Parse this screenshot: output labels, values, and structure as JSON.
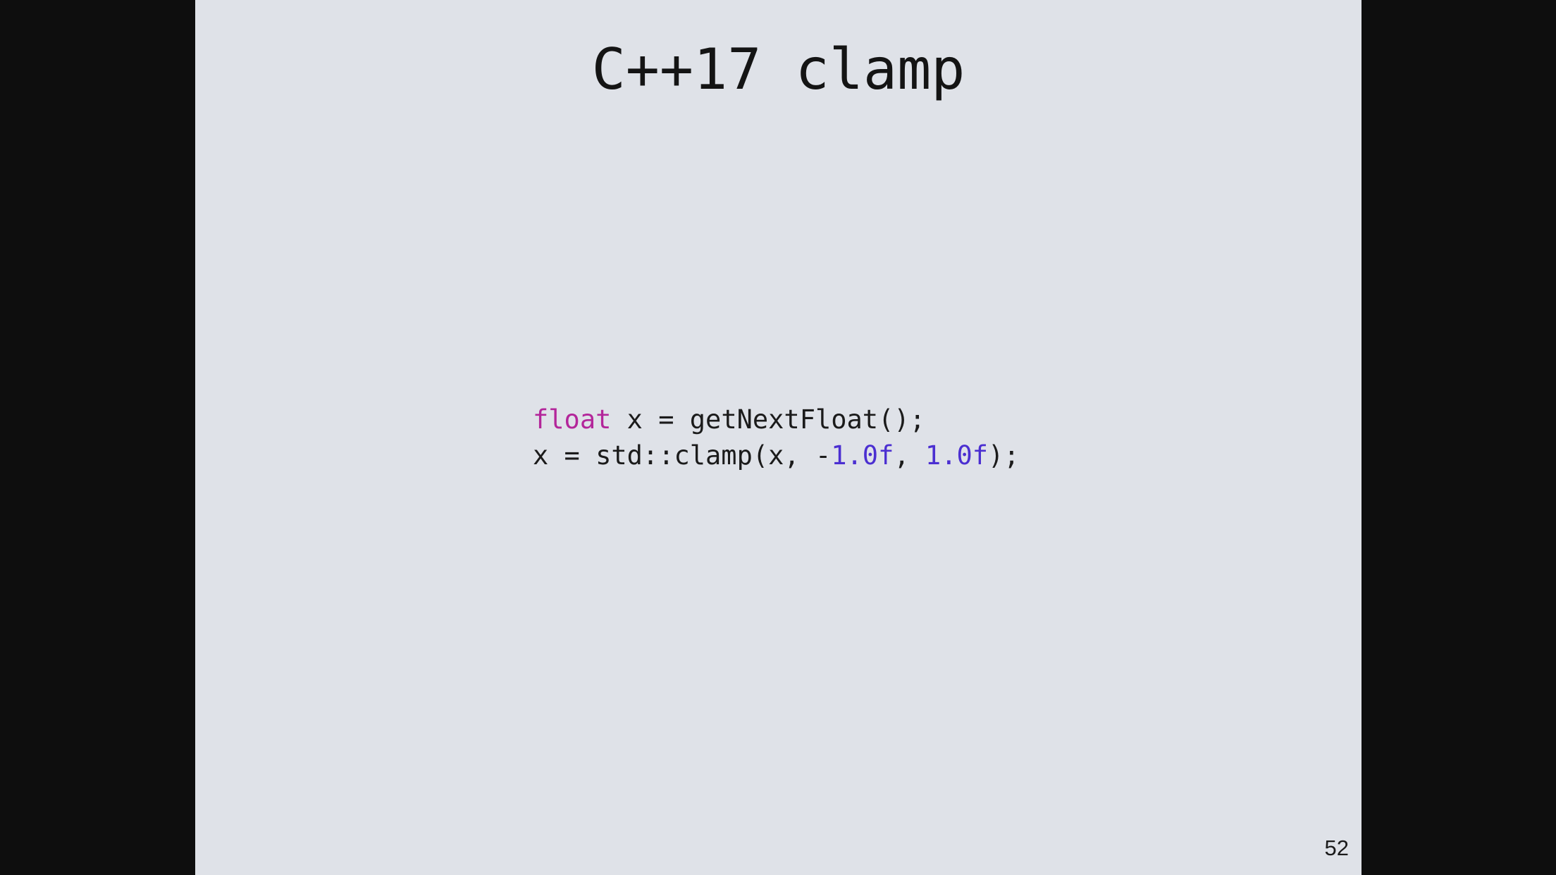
{
  "slide": {
    "title": "C++17 clamp",
    "page_number": "52",
    "background_color": "#dfe2e8",
    "frame_color": "#0e0e0e",
    "code": {
      "line1": [
        {
          "type": "keyword",
          "text": "float"
        },
        {
          "type": "plain",
          "text": " x = getNextFloat();"
        }
      ],
      "line2": [
        {
          "type": "plain",
          "text": "x = std::clamp(x, -"
        },
        {
          "type": "number",
          "text": "1.0f"
        },
        {
          "type": "plain",
          "text": ", "
        },
        {
          "type": "number",
          "text": "1.0f"
        },
        {
          "type": "plain",
          "text": ");"
        }
      ]
    },
    "colors": {
      "keyword": "#b3269a",
      "number": "#4b2fd1",
      "text": "#1b1b1b"
    }
  }
}
